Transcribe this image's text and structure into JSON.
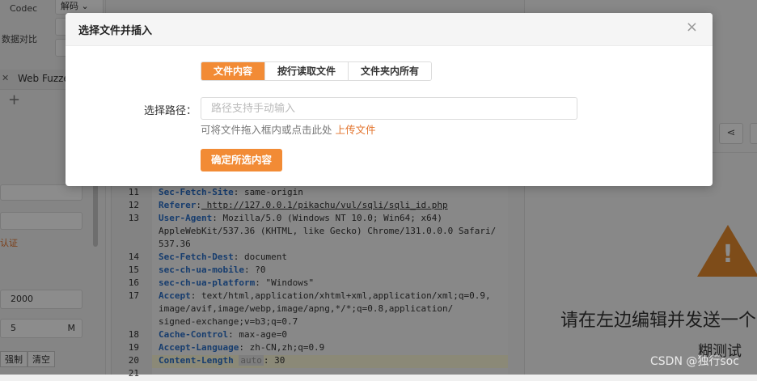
{
  "background": {
    "left": {
      "codec_label": "Codec",
      "decode_select": "解码",
      "data_compare_label": "数据对比",
      "tab_label": "Web Fuzzer",
      "auth_label": "认证",
      "value1": "2000",
      "value2": "5",
      "value2_unit": "M",
      "force_button": "强制",
      "clear_button": "清空"
    },
    "editor": {
      "lines": [
        {
          "no": "11",
          "key": "Sec-Fetch-Site",
          "sep": ":",
          "val": " same-origin"
        },
        {
          "no": "12",
          "key": "Referer",
          "sep": ":",
          "val": " http://127.0.0.1/pikachu/vul/sqli/sqli_id.php"
        },
        {
          "no": "13",
          "key": "User-Agent",
          "sep": ":",
          "val": " Mozilla/5.0 (Windows NT 10.0; Win64; x64)"
        },
        {
          "no": "",
          "key": "",
          "sep": "",
          "val": "AppleWebKit/537.36 (KHTML, like Gecko) Chrome/131.0.0.0 Safari/"
        },
        {
          "no": "",
          "key": "",
          "sep": "",
          "val": "537.36"
        },
        {
          "no": "14",
          "key": "Sec-Fetch-Dest",
          "sep": ":",
          "val": " document"
        },
        {
          "no": "15",
          "key": "sec-ch-ua-mobile",
          "sep": ":",
          "val": " ?0"
        },
        {
          "no": "16",
          "key": "sec-ch-ua-platform",
          "sep": ":",
          "val": " \"Windows\""
        },
        {
          "no": "17",
          "key": "Accept",
          "sep": ":",
          "val": " text/html,application/xhtml+xml,application/xml;q=0.9,"
        },
        {
          "no": "",
          "key": "",
          "sep": "",
          "val": "image/avif,image/webp,image/apng,*/*;q=0.8,application/"
        },
        {
          "no": "",
          "key": "",
          "sep": "",
          "val": "signed-exchange;v=b3;q=0.7"
        },
        {
          "no": "18",
          "key": "Cache-Control",
          "sep": ":",
          "val": " max-age=0"
        },
        {
          "no": "19",
          "key": "Accept-Language",
          "sep": ":",
          "val": " zh-CN,zh;q=0.9"
        },
        {
          "no": "20",
          "key": "Content-Length",
          "sep": "",
          "val": " 30",
          "tag": "auto"
        },
        {
          "no": "21",
          "key": "",
          "sep": "",
          "val": ""
        }
      ]
    },
    "right": {
      "hint_line1": "请在左边编辑并发送一个",
      "hint_line2": "糊测试",
      "watermark": "CSDN @独行soc"
    }
  },
  "modal": {
    "title": "选择文件并插入",
    "close_symbol": "×",
    "tabs": [
      {
        "label": "文件内容",
        "active": true
      },
      {
        "label": "按行读取文件",
        "active": false
      },
      {
        "label": "文件夹内所有",
        "active": false
      }
    ],
    "path_label": "选择路径：",
    "path_placeholder": "路径支持手动输入",
    "path_value": "",
    "drag_hint": "可将文件拖入框内或点击此处",
    "upload_link": "上传文件",
    "confirm_button": "确定所选内容"
  },
  "colors": {
    "accent": "#f28b35",
    "warning": "#e68a2f",
    "link": "#e2722a"
  }
}
